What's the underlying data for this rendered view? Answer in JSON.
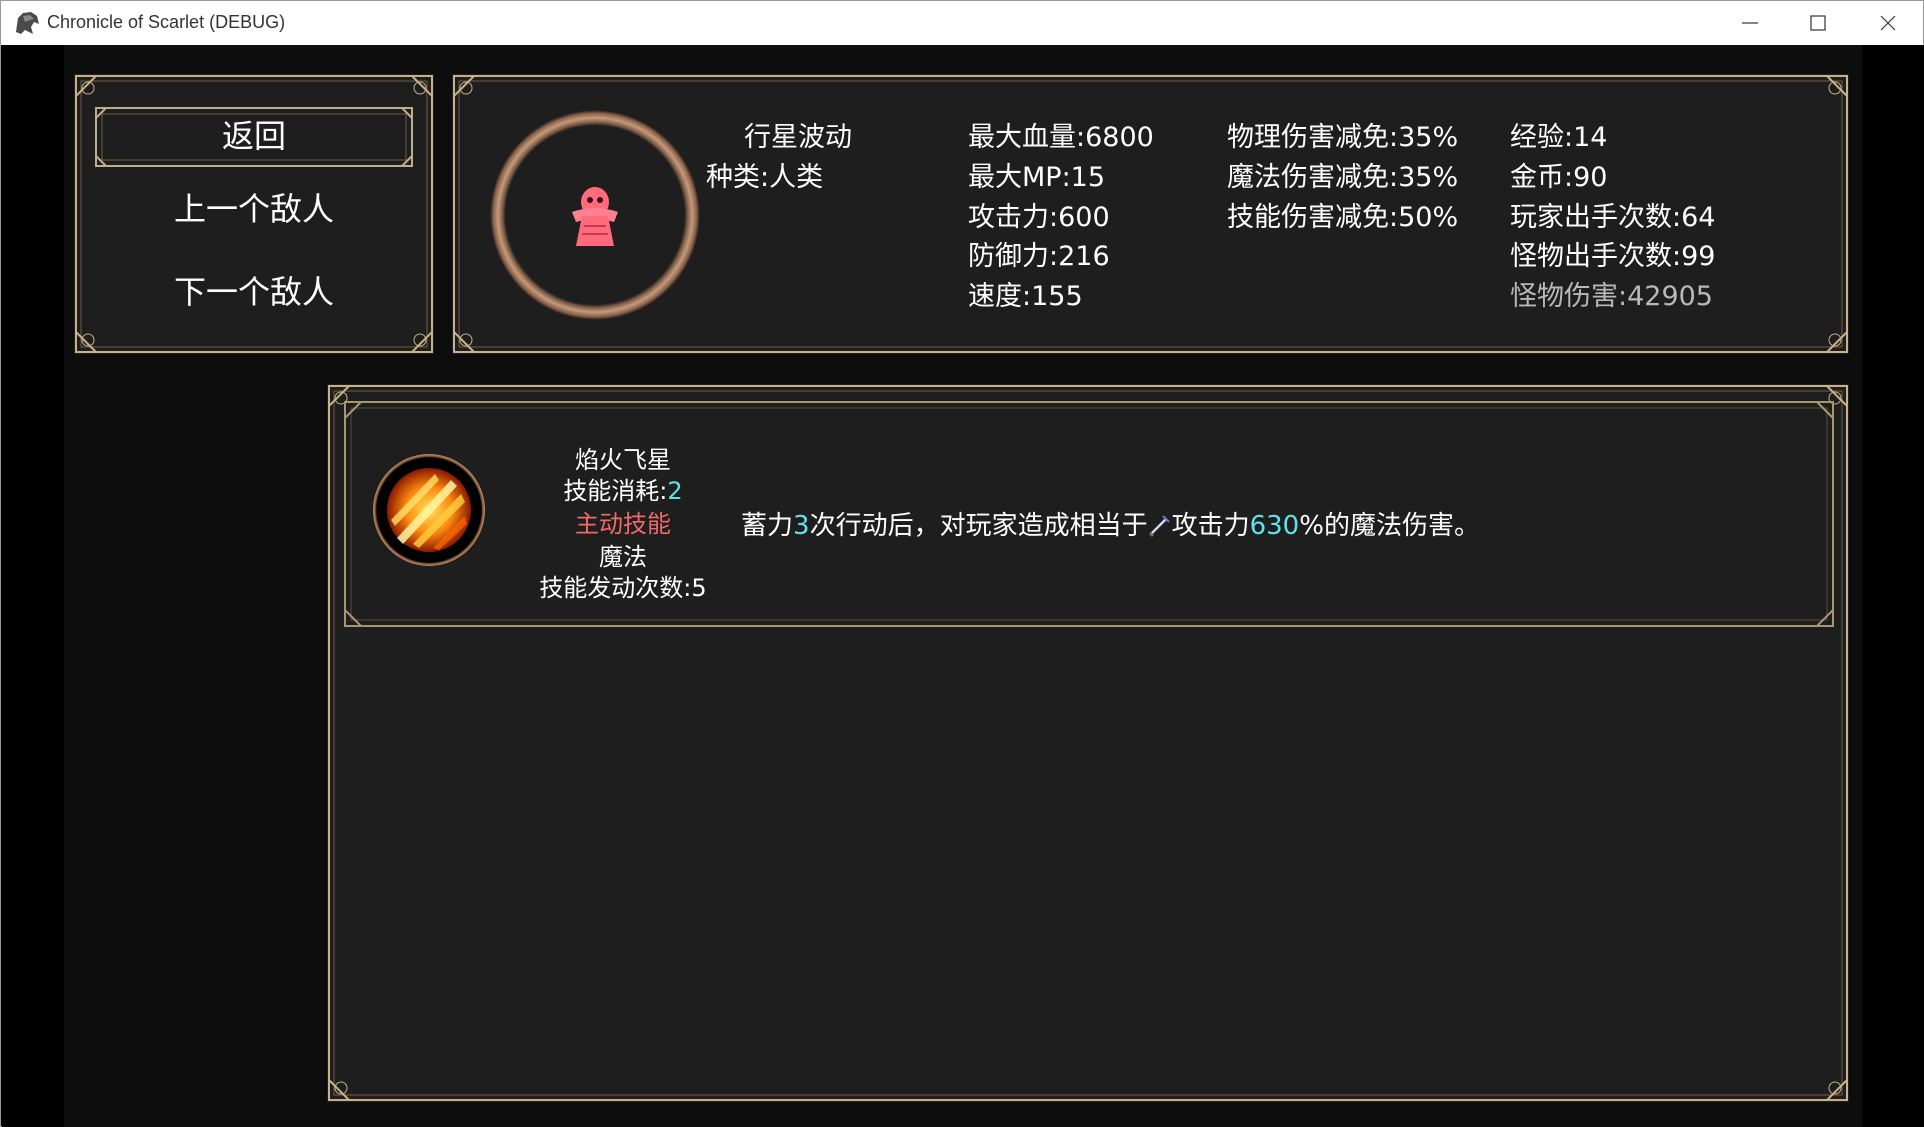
{
  "window": {
    "title": "Chronicle of Scarlet (DEBUG)",
    "controls": [
      "minimize-icon",
      "maximize-icon",
      "close-icon"
    ]
  },
  "menu": {
    "return": "返回",
    "prev": "上一个敌人",
    "next": "下一个敌人"
  },
  "enemy": {
    "name": "行星波动",
    "type": "种类:人类",
    "portrait_icon": "red-ghost-sprite",
    "col1": [
      "最大血量:6800",
      "最大MP:15",
      "攻击力:600",
      "防御力:216",
      "速度:155"
    ],
    "col2": [
      "物理伤害减免:35%",
      "魔法伤害减免:35%",
      "技能伤害减免:50%"
    ],
    "col3": [
      "经验:14",
      "金币:90",
      "玩家出手次数:64",
      "怪物出手次数:99"
    ],
    "monster_damage": "怪物伤害:42905"
  },
  "skill": {
    "name": "焰火飞星",
    "cost_label": "技能消耗:",
    "cost_value": "2",
    "kind": "主动技能",
    "element": "魔法",
    "trigger_count": "技能发动次数:5",
    "icon": "fire-streak-icon",
    "desc": {
      "pre": "蓄力",
      "charge": "3",
      "mid": "次行动后，对玩家造成相当于",
      "attack_icon": "sword-icon",
      "stat": "攻击力",
      "percent": "630",
      "post": "%的魔法伤害。"
    }
  },
  "colors": {
    "panel": "#1e1e1e",
    "highlight": "#62e0e8",
    "active_skill": "#f06a6a",
    "frame_gold": "#c8b088"
  }
}
